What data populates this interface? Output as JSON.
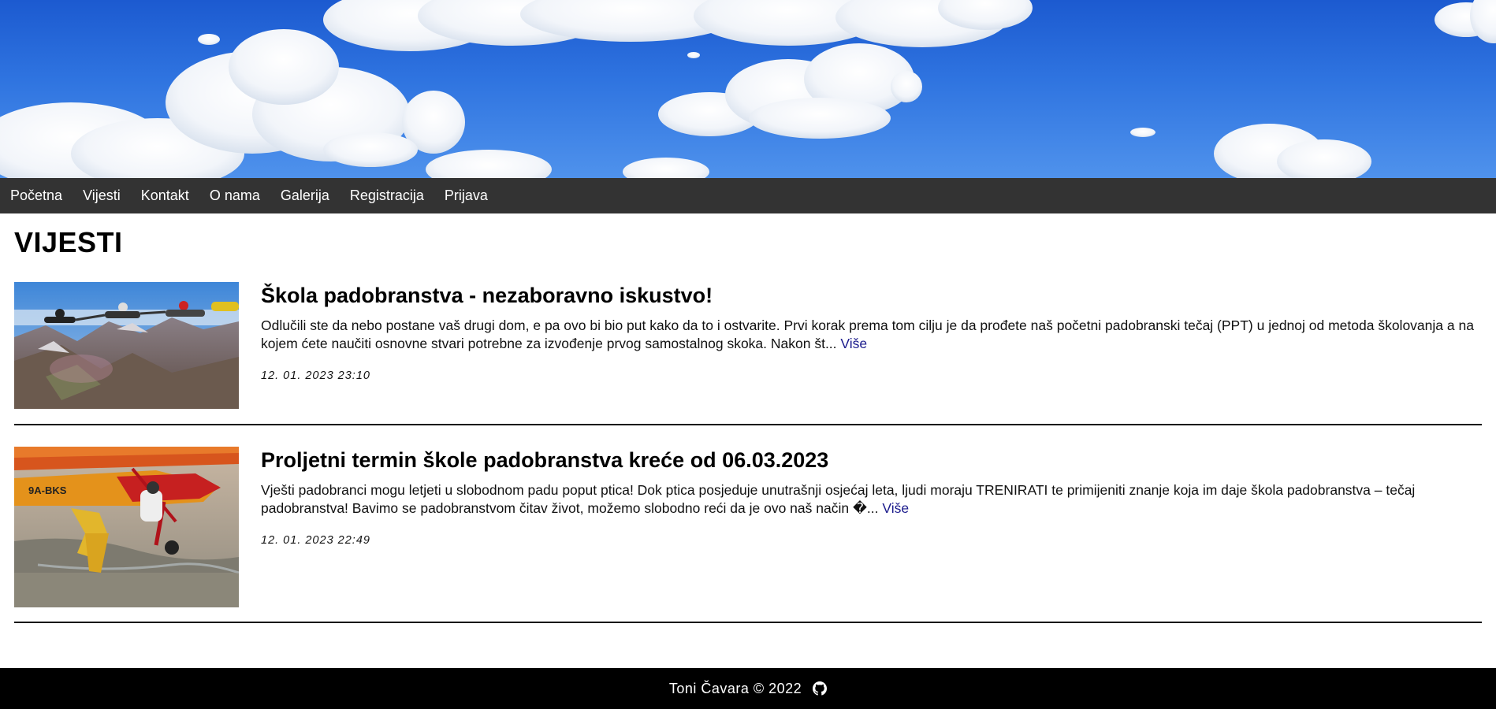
{
  "nav": {
    "items": [
      "Početna",
      "Vijesti",
      "Kontakt",
      "O nama",
      "Galerija",
      "Registracija",
      "Prijava"
    ]
  },
  "page": {
    "title": "VIJESTI"
  },
  "articles": [
    {
      "title": "Škola padobranstva - nezaboravno iskustvo!",
      "excerpt": "Odlučili ste da nebo postane vaš drugi dom, e pa ovo bi bio put kako da to i ostvarite. Prvi korak prema tom cilju je da prođete naš početni padobranski tečaj (PPT) u jednoj od metoda školovanja a na kojem ćete naučiti osnovne stvari potrebne za izvođenje prvog samostalnog skoka. Nakon št...",
      "more_label": "Više",
      "date": "12. 01. 2023 23:10",
      "image": "skydivers-formation-over-mountains"
    },
    {
      "title": "Proljetni termin škole padobranstva kreće od 06.03.2023",
      "excerpt": "Vješti padobranci mogu letjeti u slobodnom padu poput ptica! Dok ptica posjeduje unutrašnji osjećaj leta, ljudi moraju TRENIRATI te primijeniti znanje koja im daje škola padobranstva – tečaj padobranstva! Bavimo se padobranstvom čitav život, možemo slobodno reći da je ovo naš način �...",
      "more_label": "Više",
      "date": "12. 01. 2023 22:49",
      "image": "skydiver-exiting-red-plane",
      "plane_registration": "9A-BKS"
    }
  ],
  "footer": {
    "text": "Toni Čavara © 2022",
    "icon": "github-icon"
  },
  "colors": {
    "navbar_bg": "#333333",
    "footer_bg": "#000000",
    "link": "#1a1a8c",
    "sky": "#2f74e0"
  }
}
